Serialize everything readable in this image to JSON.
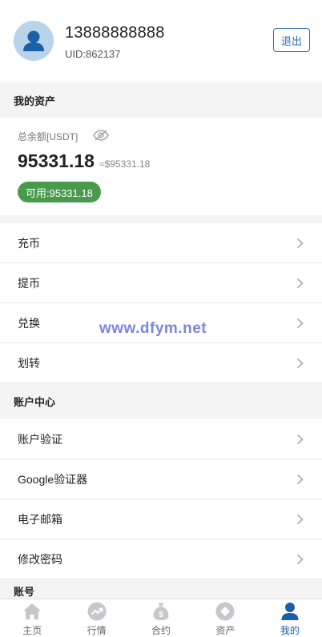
{
  "profile": {
    "phone": "13888888888",
    "uid": "UID:862137",
    "logout_label": "退出"
  },
  "assets": {
    "section_title": "我的资产",
    "total_label": "总余额[USDT]",
    "balance": "95331.18",
    "balance_usd": "≈$95331.18",
    "available": "可用:95331.18"
  },
  "asset_menu": [
    {
      "label": "充币"
    },
    {
      "label": "提币"
    },
    {
      "label": "兑换"
    },
    {
      "label": "划转"
    }
  ],
  "account_center": {
    "section_title": "账户中心",
    "items": [
      {
        "label": "账户验证"
      },
      {
        "label": "Google验证器"
      },
      {
        "label": "电子邮箱"
      },
      {
        "label": "修改密码"
      }
    ]
  },
  "account_section": {
    "section_title": "账号"
  },
  "watermark": "www.dfym.net",
  "tabbar": {
    "tabs": [
      {
        "label": "主页",
        "icon": "home-icon"
      },
      {
        "label": "行情",
        "icon": "trend-icon"
      },
      {
        "label": "合约",
        "icon": "money-bag-icon"
      },
      {
        "label": "资产",
        "icon": "diamond-icon"
      },
      {
        "label": "我的",
        "icon": "user-icon"
      }
    ],
    "active_index": 4
  },
  "colors": {
    "accent": "#1b5fa8",
    "available_bg": "#4a9a4e",
    "section_bg": "#f4f4f4",
    "inactive_icon": "#c4c8cc"
  }
}
